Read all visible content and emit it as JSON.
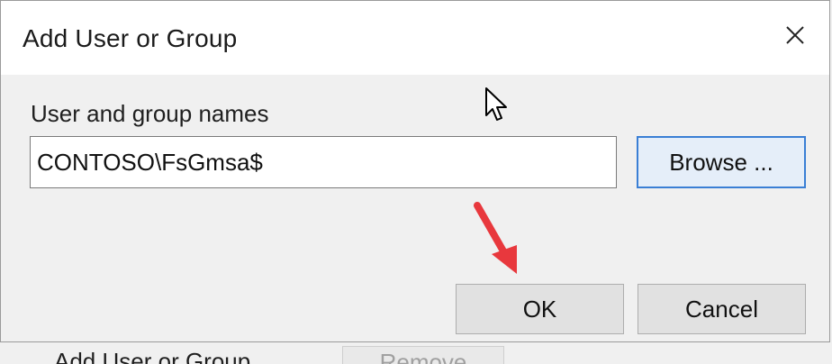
{
  "dialog": {
    "title": "Add User or Group",
    "close_icon": "close-icon",
    "field_label": "User and group names",
    "names_value": "CONTOSO\\FsGmsa$",
    "browse_label": "Browse ...",
    "ok_label": "OK",
    "cancel_label": "Cancel"
  },
  "background_window": {
    "add_label": "Add User or Group",
    "remove_label": "Remove"
  },
  "overlay": {
    "cursor_icon": "mouse-pointer-icon",
    "annotation_icon": "red-arrow-icon",
    "annotation_color": "#e8383d",
    "focus_accent": "#3a7fd5"
  }
}
